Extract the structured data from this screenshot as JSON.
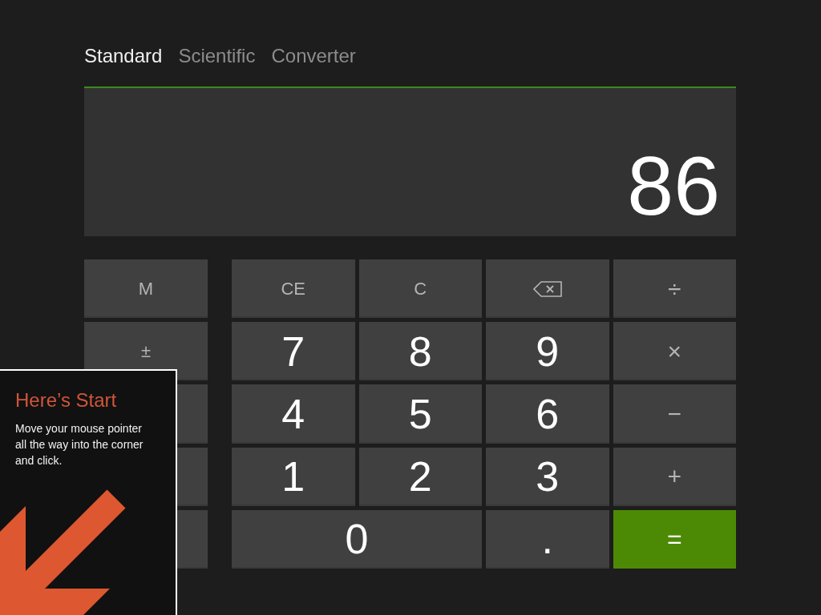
{
  "tabs": [
    {
      "label": "Standard",
      "selected": true
    },
    {
      "label": "Scientific",
      "selected": false
    },
    {
      "label": "Converter",
      "selected": false
    }
  ],
  "display": {
    "value": "86"
  },
  "side_keys": [
    {
      "kind": "text",
      "label": "M"
    },
    {
      "kind": "text",
      "label": "±"
    },
    {
      "kind": "covered"
    },
    {
      "kind": "covered"
    },
    {
      "kind": "covered"
    }
  ],
  "keys": [
    {
      "kind": "function",
      "label": "CE",
      "wide": false
    },
    {
      "kind": "function",
      "label": "C",
      "wide": false
    },
    {
      "kind": "backspace",
      "wide": false
    },
    {
      "kind": "operator",
      "label": "÷",
      "wide": false
    },
    {
      "kind": "digit",
      "label": "7",
      "wide": false
    },
    {
      "kind": "digit",
      "label": "8",
      "wide": false
    },
    {
      "kind": "digit",
      "label": "9",
      "wide": false
    },
    {
      "kind": "operator",
      "label": "×",
      "wide": false
    },
    {
      "kind": "digit",
      "label": "4",
      "wide": false
    },
    {
      "kind": "digit",
      "label": "5",
      "wide": false
    },
    {
      "kind": "digit",
      "label": "6",
      "wide": false
    },
    {
      "kind": "operator",
      "label": "−",
      "wide": false
    },
    {
      "kind": "digit",
      "label": "1",
      "wide": false
    },
    {
      "kind": "digit",
      "label": "2",
      "wide": false
    },
    {
      "kind": "digit",
      "label": "3",
      "wide": false
    },
    {
      "kind": "operator",
      "label": "+",
      "wide": false
    },
    {
      "kind": "digit",
      "label": "0",
      "wide": true
    },
    {
      "kind": "digit",
      "label": ".",
      "wide": false
    },
    {
      "kind": "equals",
      "label": "=",
      "wide": false
    }
  ],
  "tip": {
    "title": "Here’s Start",
    "text": "Move your mouse pointer all the way into the corner and click."
  }
}
